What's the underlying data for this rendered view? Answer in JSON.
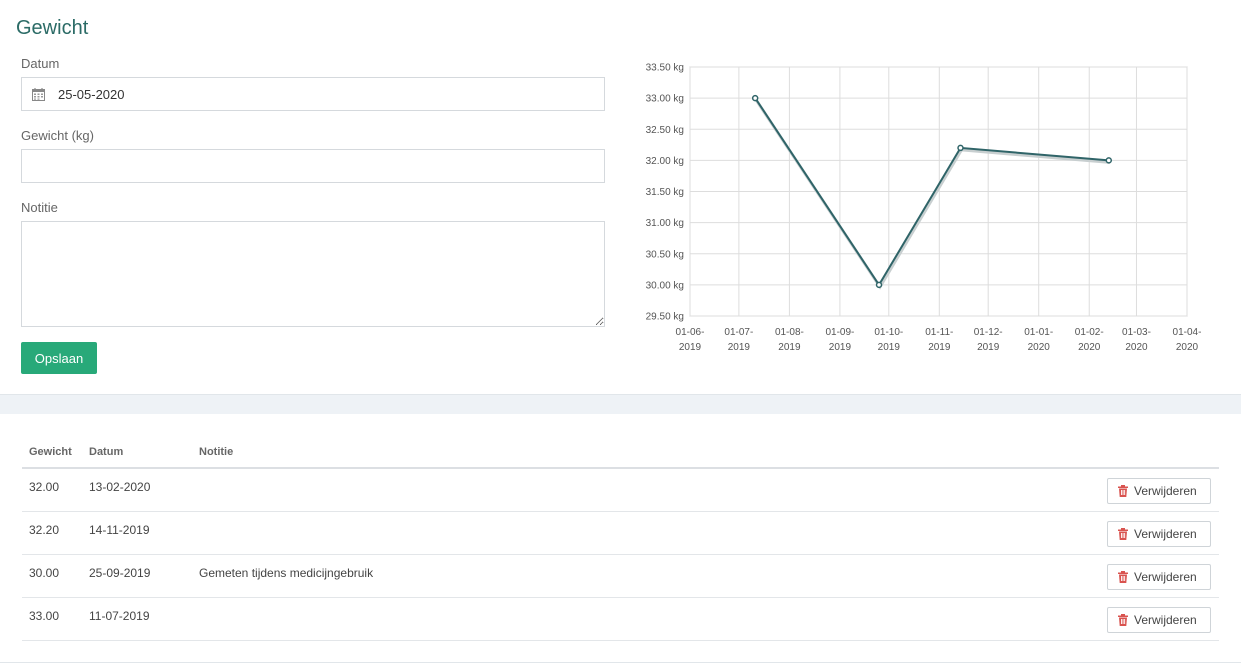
{
  "form": {
    "title": "Gewicht",
    "date_label": "Datum",
    "date_value": "25-05-2020",
    "weight_label": "Gewicht (kg)",
    "weight_value": "",
    "note_label": "Notitie",
    "note_value": "",
    "save_label": "Opslaan",
    "accent_color": "#28a979",
    "title_color": "#2b6b66"
  },
  "chart_data": {
    "type": "line",
    "series_color": "#2f6468",
    "ylim": [
      29.5,
      33.5
    ],
    "y_ticks": [
      "29.50 kg",
      "30.00 kg",
      "30.50 kg",
      "31.00 kg",
      "31.50 kg",
      "32.00 kg",
      "32.50 kg",
      "33.00 kg",
      "33.50 kg"
    ],
    "x_ticks": [
      [
        "01-06-",
        "2019"
      ],
      [
        "01-07-",
        "2019"
      ],
      [
        "01-08-",
        "2019"
      ],
      [
        "01-09-",
        "2019"
      ],
      [
        "01-10-",
        "2019"
      ],
      [
        "01-11-",
        "2019"
      ],
      [
        "01-12-",
        "2019"
      ],
      [
        "01-01-",
        "2020"
      ],
      [
        "01-02-",
        "2020"
      ],
      [
        "01-03-",
        "2020"
      ],
      [
        "01-04-",
        "2020"
      ]
    ],
    "points": [
      {
        "x": "11-07-2019",
        "y": 33.0
      },
      {
        "x": "25-09-2019",
        "y": 30.0
      },
      {
        "x": "14-11-2019",
        "y": 32.2
      },
      {
        "x": "13-02-2020",
        "y": 32.0
      }
    ],
    "grid": true
  },
  "table": {
    "headers": {
      "weight": "Gewicht",
      "date": "Datum",
      "note": "Notitie"
    },
    "delete_label": "Verwijderen",
    "rows": [
      {
        "weight": "32.00",
        "date": "13-02-2020",
        "note": ""
      },
      {
        "weight": "32.20",
        "date": "14-11-2019",
        "note": ""
      },
      {
        "weight": "30.00",
        "date": "25-09-2019",
        "note": "Gemeten tijdens medicijngebruik"
      },
      {
        "weight": "33.00",
        "date": "11-07-2019",
        "note": ""
      }
    ]
  },
  "icons": {
    "calendar": "calendar-icon",
    "trash": "trash-icon"
  }
}
